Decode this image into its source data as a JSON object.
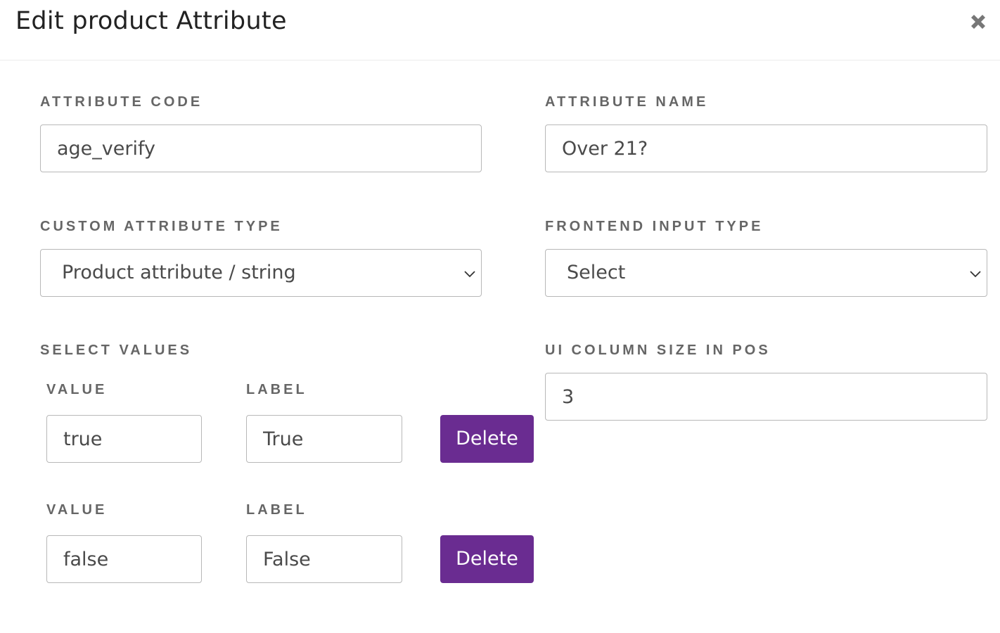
{
  "header": {
    "title": "Edit product Attribute",
    "close_icon": "close-x-icon"
  },
  "form": {
    "attribute_code": {
      "label": "ATTRIBUTE CODE",
      "value": "age_verify"
    },
    "attribute_name": {
      "label": "ATTRIBUTE NAME",
      "value": "Over 21?"
    },
    "custom_attribute_type": {
      "label": "CUSTOM ATTRIBUTE TYPE",
      "selected": "Product attribute / string"
    },
    "frontend_input_type": {
      "label": "FRONTEND INPUT TYPE",
      "selected": "Select"
    },
    "ui_column_size": {
      "label": "UI COLUMN SIZE IN POS",
      "value": "3"
    }
  },
  "select_values": {
    "label": "SELECT VALUES",
    "rows": [
      {
        "value_label": "VALUE",
        "label_label": "LABEL",
        "value": "true",
        "label": "True",
        "delete_label": "Delete"
      },
      {
        "value_label": "VALUE",
        "label_label": "LABEL",
        "value": "false",
        "label": "False",
        "delete_label": "Delete"
      }
    ]
  },
  "colors": {
    "accent": "#6a2c91",
    "label_text": "#666666",
    "input_border": "#b8b8b8"
  }
}
